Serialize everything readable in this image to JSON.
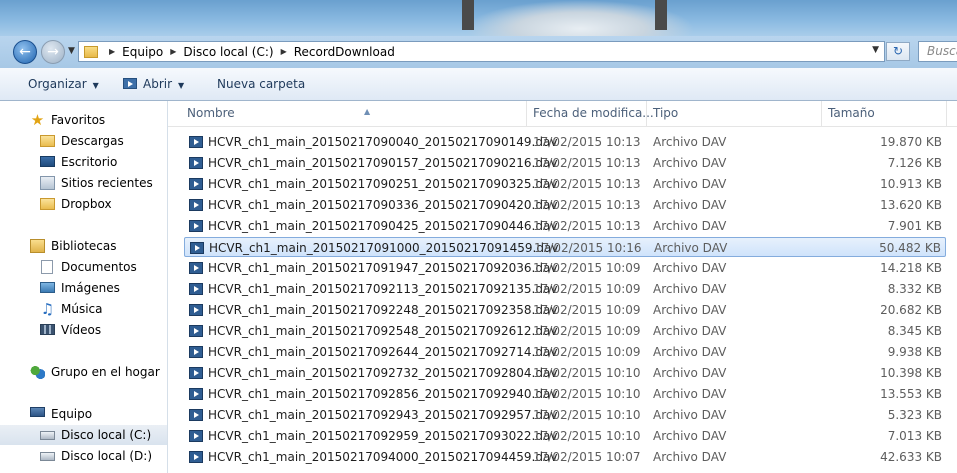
{
  "address": {
    "crumbs": [
      "Equipo",
      "Disco local (C:)",
      "RecordDownload"
    ],
    "search_placeholder": "Buscar"
  },
  "toolbar": {
    "organize": "Organizar",
    "open": "Abrir",
    "new_folder": "Nueva carpeta"
  },
  "navpane": {
    "favorites": "Favoritos",
    "downloads": "Descargas",
    "desktop": "Escritorio",
    "recent": "Sitios recientes",
    "dropbox": "Dropbox",
    "libraries": "Bibliotecas",
    "documents": "Documentos",
    "images": "Imágenes",
    "music": "Música",
    "videos": "Vídeos",
    "homegroup": "Grupo en el hogar",
    "computer": "Equipo",
    "drive_c": "Disco local (C:)",
    "drive_d": "Disco local (D:)"
  },
  "columns": {
    "name": "Nombre",
    "date": "Fecha de modifica...",
    "type": "Tipo",
    "size": "Tamaño"
  },
  "files": [
    {
      "name": "HCVR_ch1_main_20150217090040_20150217090149.dav",
      "date": "17/02/2015 10:13",
      "type": "Archivo DAV",
      "size": "19.870 KB"
    },
    {
      "name": "HCVR_ch1_main_20150217090157_20150217090216.dav",
      "date": "17/02/2015 10:13",
      "type": "Archivo DAV",
      "size": "7.126 KB"
    },
    {
      "name": "HCVR_ch1_main_20150217090251_20150217090325.dav",
      "date": "17/02/2015 10:13",
      "type": "Archivo DAV",
      "size": "10.913 KB"
    },
    {
      "name": "HCVR_ch1_main_20150217090336_20150217090420.dav",
      "date": "17/02/2015 10:13",
      "type": "Archivo DAV",
      "size": "13.620 KB"
    },
    {
      "name": "HCVR_ch1_main_20150217090425_20150217090446.dav",
      "date": "17/02/2015 10:13",
      "type": "Archivo DAV",
      "size": "7.901 KB"
    },
    {
      "name": "HCVR_ch1_main_20150217091000_20150217091459.dav",
      "date": "17/02/2015 10:16",
      "type": "Archivo DAV",
      "size": "50.482 KB"
    },
    {
      "name": "HCVR_ch1_main_20150217091947_20150217092036.dav",
      "date": "17/02/2015 10:09",
      "type": "Archivo DAV",
      "size": "14.218 KB"
    },
    {
      "name": "HCVR_ch1_main_20150217092113_20150217092135.dav",
      "date": "17/02/2015 10:09",
      "type": "Archivo DAV",
      "size": "8.332 KB"
    },
    {
      "name": "HCVR_ch1_main_20150217092248_20150217092358.dav",
      "date": "17/02/2015 10:09",
      "type": "Archivo DAV",
      "size": "20.682 KB"
    },
    {
      "name": "HCVR_ch1_main_20150217092548_20150217092612.dav",
      "date": "17/02/2015 10:09",
      "type": "Archivo DAV",
      "size": "8.345 KB"
    },
    {
      "name": "HCVR_ch1_main_20150217092644_20150217092714.dav",
      "date": "17/02/2015 10:09",
      "type": "Archivo DAV",
      "size": "9.938 KB"
    },
    {
      "name": "HCVR_ch1_main_20150217092732_20150217092804.dav",
      "date": "17/02/2015 10:10",
      "type": "Archivo DAV",
      "size": "10.398 KB"
    },
    {
      "name": "HCVR_ch1_main_20150217092856_20150217092940.dav",
      "date": "17/02/2015 10:10",
      "type": "Archivo DAV",
      "size": "13.553 KB"
    },
    {
      "name": "HCVR_ch1_main_20150217092943_20150217092957.dav",
      "date": "17/02/2015 10:10",
      "type": "Archivo DAV",
      "size": "5.323 KB"
    },
    {
      "name": "HCVR_ch1_main_20150217092959_20150217093022.dav",
      "date": "17/02/2015 10:10",
      "type": "Archivo DAV",
      "size": "7.013 KB"
    },
    {
      "name": "HCVR_ch1_main_20150217094000_20150217094459.dav",
      "date": "17/02/2015 10:07",
      "type": "Archivo DAV",
      "size": "42.633 KB"
    }
  ],
  "selected_index": 5
}
